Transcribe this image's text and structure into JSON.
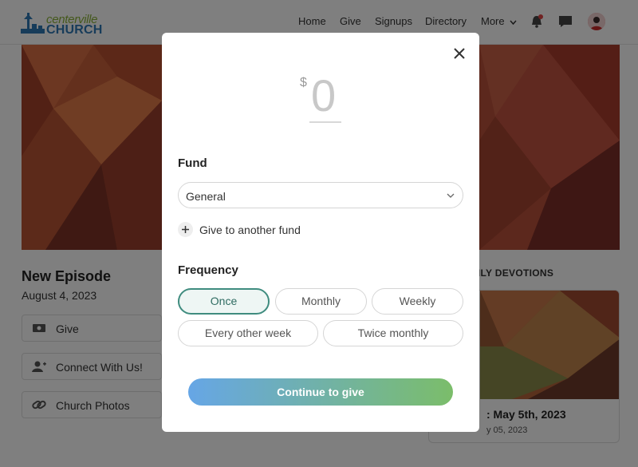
{
  "header": {
    "logo_line1": "centerville",
    "logo_line2": "CHURCH",
    "nav": [
      "Home",
      "Give",
      "Signups",
      "Directory",
      "More"
    ]
  },
  "page": {
    "episode_title": "New Episode",
    "episode_date": "August 4, 2023",
    "actions": [
      "Give",
      "Connect With Us!",
      "Church Photos"
    ],
    "devotions_heading": "M DAILY DEVOTIONS",
    "devotion_title": ": May 5th, 2023",
    "devotion_date": "y 05, 2023"
  },
  "modal": {
    "currency_symbol": "$",
    "amount": "0",
    "fund_title": "Fund",
    "fund_selected": "General",
    "add_fund_label": "Give to another fund",
    "frequency_title": "Frequency",
    "frequency_options": [
      "Once",
      "Monthly",
      "Weekly",
      "Every other week",
      "Twice monthly"
    ],
    "frequency_selected": "Once",
    "cta_label": "Continue to give"
  },
  "colors": {
    "accent": "#3f8c7f",
    "cta_start": "#66a6e6",
    "cta_end": "#7bbd6a",
    "logo_blue": "#2f79b5",
    "logo_green": "#8ab33b"
  },
  "icons": [
    "notification-bell-icon",
    "chat-icon",
    "avatar",
    "money-icon",
    "add-person-icon",
    "link-icon",
    "close-icon",
    "chevron-down-icon",
    "plus-icon"
  ]
}
